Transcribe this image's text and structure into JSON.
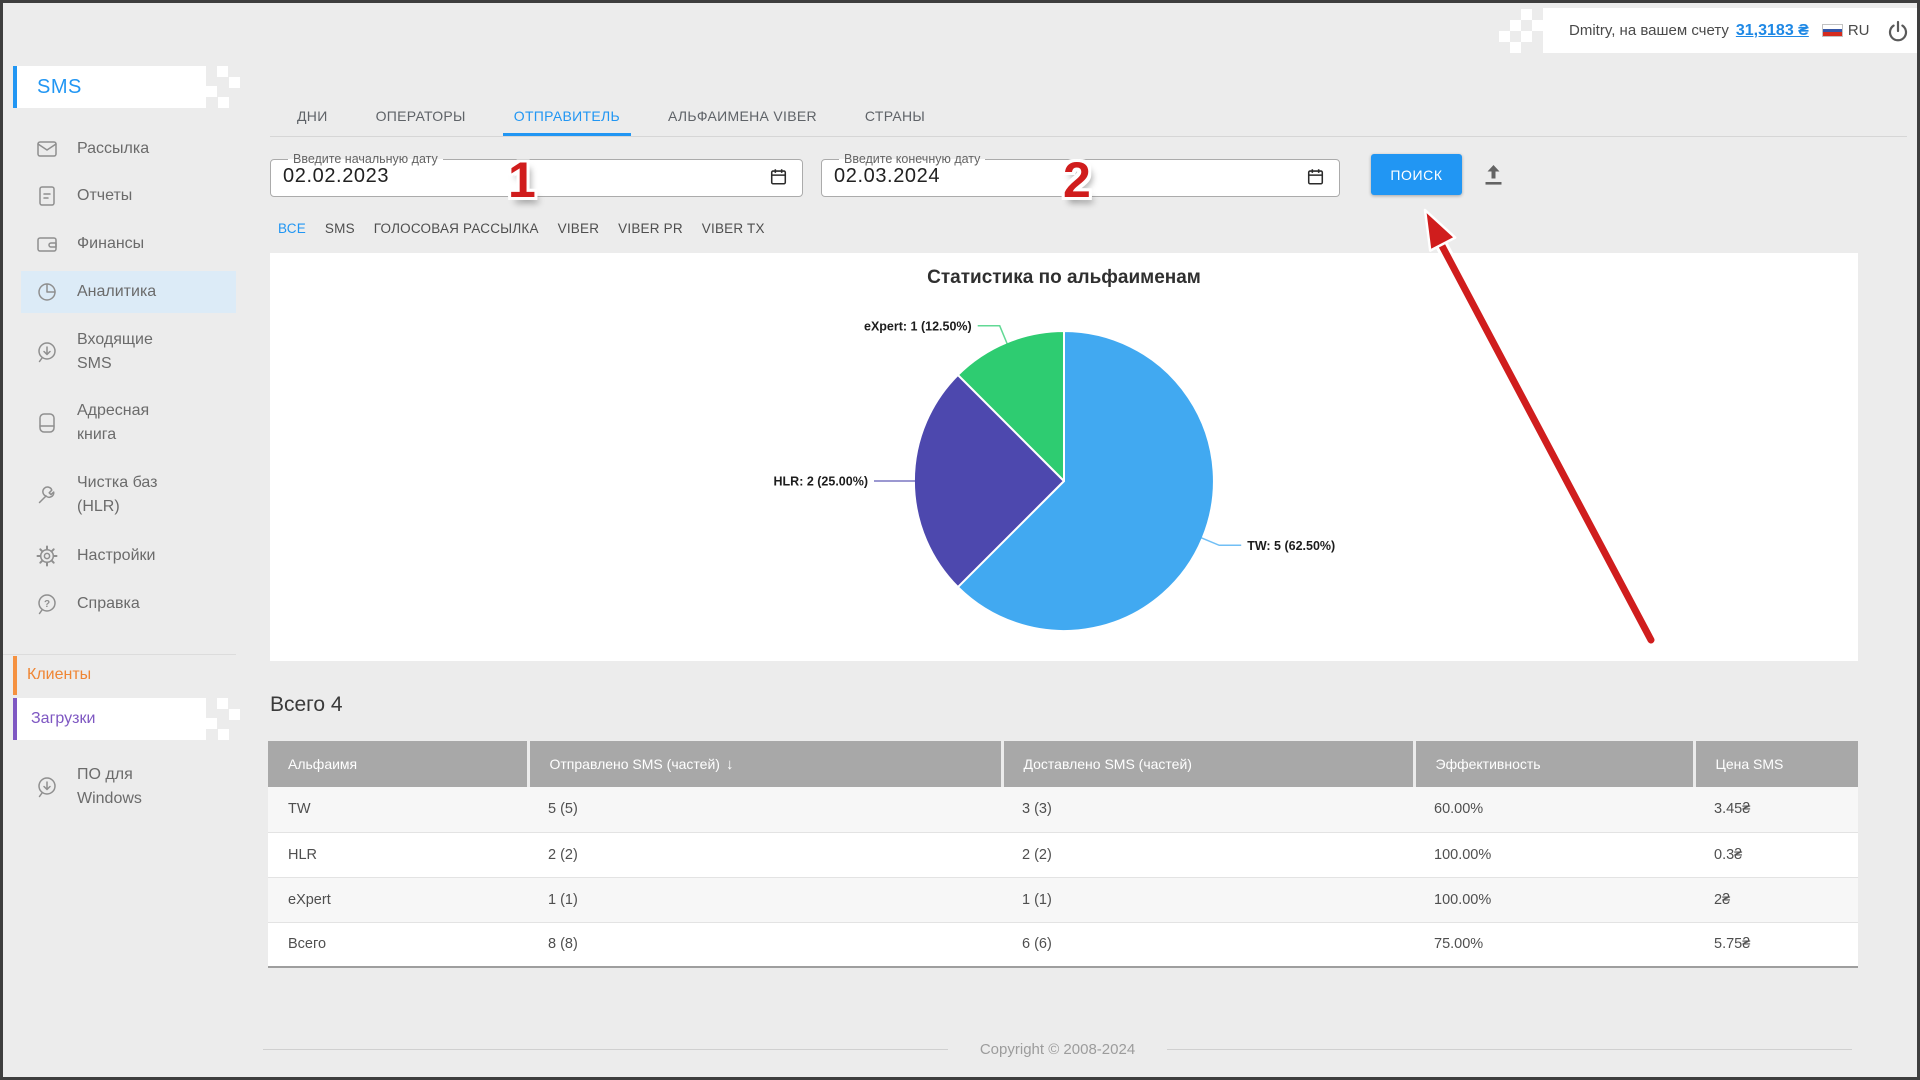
{
  "header": {
    "user_label": "Dmitry, на вашем счету",
    "balance": "31,3183 ₴",
    "lang": "RU"
  },
  "sidebar": {
    "logo": "SMS",
    "items": [
      {
        "label": "Рассылка",
        "icon": "envelope-icon"
      },
      {
        "label": "Отчеты",
        "icon": "report-icon"
      },
      {
        "label": "Финансы",
        "icon": "wallet-icon"
      },
      {
        "label": "Аналитика",
        "icon": "pie-icon",
        "active": true
      },
      {
        "label": "Входящие SMS",
        "icon": "incoming-bubble-icon"
      },
      {
        "label": "Адресная книга",
        "icon": "address-book-icon"
      },
      {
        "label": "Чистка баз (HLR)",
        "icon": "wrench-icon"
      },
      {
        "label": "Настройки",
        "icon": "gear-icon"
      },
      {
        "label": "Справка",
        "icon": "help-bubble-icon"
      }
    ],
    "clients_section": "Клиенты",
    "downloads_section": "Загрузки",
    "downloads_item": "ПО для Windows",
    "accent_orange": "#ef8533",
    "accent_purple": "#7e57c2",
    "accent_blue": "#2196f3"
  },
  "tabs": [
    {
      "label": "ДНИ"
    },
    {
      "label": "ОПЕРАТОРЫ"
    },
    {
      "label": "ОТПРАВИТЕЛЬ",
      "active": true
    },
    {
      "label": "АЛЬФАИМЕНА VIBER"
    },
    {
      "label": "СТРАНЫ"
    }
  ],
  "search": {
    "start_label": "Введите начальную дату",
    "start_value": "02.02.2023",
    "end_label": "Введите конечную дату",
    "end_value": "02.03.2024",
    "button": "ПОИСК"
  },
  "type_filters": [
    {
      "label": "ВСЕ",
      "active": true
    },
    {
      "label": "SMS"
    },
    {
      "label": "ГОЛОСОВАЯ РАССЫЛКА"
    },
    {
      "label": "VIBER"
    },
    {
      "label": "VIBER PR"
    },
    {
      "label": "VIBER TX"
    }
  ],
  "chart_data": {
    "type": "pie",
    "title": "Статистика по альфаименам",
    "labels": [
      "TW",
      "HLR",
      "eXpert"
    ],
    "values": [
      5,
      2,
      1
    ],
    "percentages": [
      62.5,
      25.0,
      12.5
    ],
    "slice_labels": [
      "TW: 5 (62.50%)",
      "HLR: 2 (25.00%)",
      "eXpert: 1 (12.50%)"
    ],
    "colors": [
      "#41a9f1",
      "#4d48ae",
      "#2ecc71"
    ],
    "start_angle_deg": 0,
    "direction": "clockwise",
    "legend_position": "outside-leader-lines"
  },
  "table": {
    "caption": "Всего 4",
    "columns": [
      "Альфаимя",
      "Отправлено SMS (частей)",
      "Доставлено SMS (частей)",
      "Эффективность",
      "Цена SMS"
    ],
    "sort_icon": "↓",
    "rows": [
      [
        "TW",
        "5 (5)",
        "3 (3)",
        "60.00%",
        "3.45₴"
      ],
      [
        "HLR",
        "2 (2)",
        "2 (2)",
        "100.00%",
        "0.3₴"
      ],
      [
        "eXpert",
        "1 (1)",
        "1 (1)",
        "100.00%",
        "2₴"
      ],
      [
        "Всего",
        "8 (8)",
        "6 (6)",
        "75.00%",
        "5.75₴"
      ]
    ]
  },
  "footer": {
    "copyright": "Copyright © 2008-2024"
  },
  "annotations": {
    "step1": "1",
    "step2": "2",
    "arrow_color": "#d01d1d"
  }
}
